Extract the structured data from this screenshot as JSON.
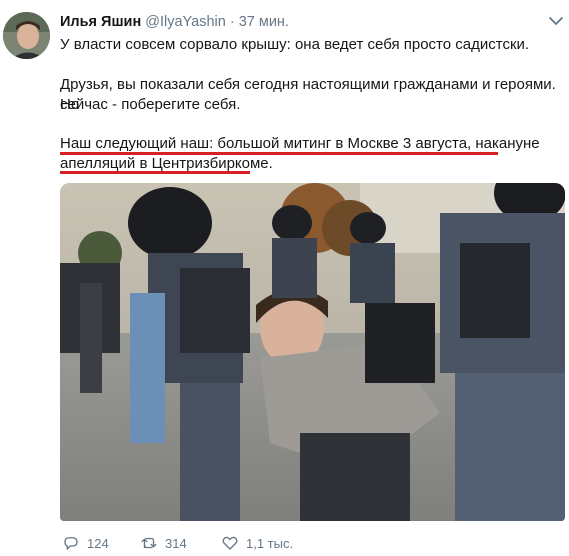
{
  "author": {
    "name": "Илья Яшин",
    "handle": "@IlyaYashin",
    "separator": "·",
    "time": "37 мин."
  },
  "tweet": {
    "line1": "У власти совсем сорвало крышу: она ведет себя просто садистски.",
    "line2": "Друзья, вы показали себя сегодня настоящими гражданами и героями. Но",
    "line3": "сейчас - поберегите себя.",
    "line4": "Наш следующий наш: большой митинг в Москве 3 августа, накануне",
    "line5": "апелляций в Центризбиркоме."
  },
  "actions": {
    "replies": "124",
    "retweets": "314",
    "likes": "1,1 тыс."
  },
  "icons": {
    "menu": "chevron-down-icon",
    "reply": "reply-icon",
    "retweet": "retweet-icon",
    "like": "heart-icon"
  },
  "colors": {
    "underline": "#d91e26",
    "secondary_text": "#657786"
  }
}
